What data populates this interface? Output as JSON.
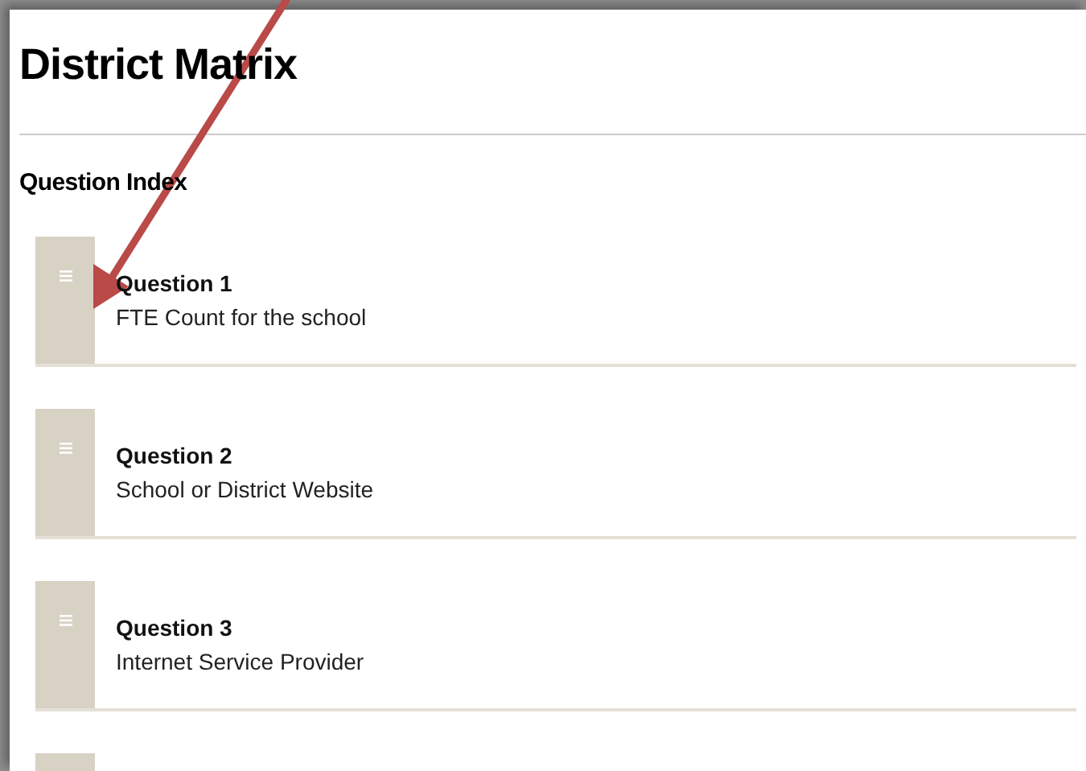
{
  "page": {
    "title": "District Matrix",
    "section_title": "Question Index"
  },
  "questions": [
    {
      "kind": "full",
      "label": "Question 1",
      "description": "FTE Count for the school"
    },
    {
      "kind": "full",
      "label": "Question 2",
      "description": "School or District Website"
    },
    {
      "kind": "full",
      "label": "Question 3",
      "description": "Internet Service Provider"
    },
    {
      "kind": "cut"
    }
  ],
  "annotation": {
    "kind": "arrow"
  }
}
